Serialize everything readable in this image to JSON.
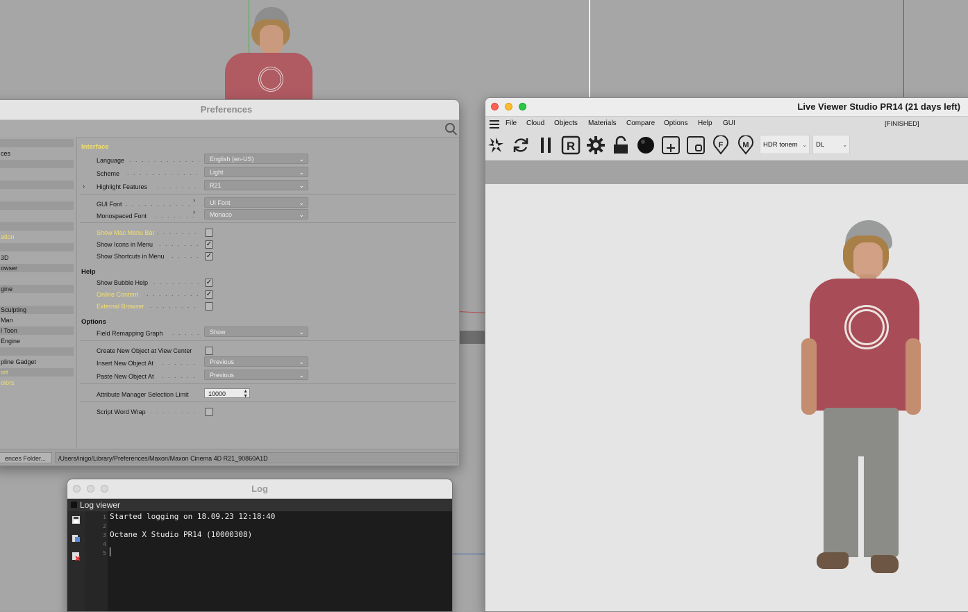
{
  "preferences": {
    "title": "Preferences",
    "sidebar": [
      {
        "label": "",
        "band": true
      },
      {
        "label": "ces",
        "band": false
      },
      {
        "label": "",
        "band": true
      },
      {
        "label": "",
        "band": false
      },
      {
        "label": "",
        "band": true
      },
      {
        "label": "",
        "band": false
      },
      {
        "label": "",
        "band": true
      },
      {
        "label": "",
        "band": false
      },
      {
        "label": "",
        "band": true
      },
      {
        "label": "ation",
        "band": false,
        "yellow": true
      },
      {
        "label": "",
        "band": true
      },
      {
        "label": "3D",
        "band": false
      },
      {
        "label": "owser",
        "band": true
      },
      {
        "label": "",
        "band": false
      },
      {
        "label": "gine",
        "band": true
      },
      {
        "label": "",
        "band": false
      },
      {
        "label": "Sculpting",
        "band": true
      },
      {
        "label": "Man",
        "band": false
      },
      {
        "label": "l Toon",
        "band": true
      },
      {
        "label": " Engine",
        "band": false
      },
      {
        "label": "",
        "band": true
      },
      {
        "label": "pline Gadget",
        "band": false
      },
      {
        "label": "ort",
        "band": true,
        "yellow": true
      },
      {
        "label": "olors",
        "band": false,
        "yellow": true
      }
    ],
    "sections": {
      "interface": "Interface",
      "help": "Help",
      "options": "Options"
    },
    "rows": {
      "language": {
        "label": "Language",
        "value": "English (en-US)"
      },
      "scheme": {
        "label": "Scheme",
        "value": "Light"
      },
      "highlight": {
        "label": "Highlight Features",
        "value": "R21"
      },
      "gui_font": {
        "label": "GUI Font",
        "value": "UI Font"
      },
      "mono_font": {
        "label": "Monospaced Font",
        "value": "Monaco"
      },
      "show_mac_menu": {
        "label": "Show Mac Menu Bar",
        "checked": false
      },
      "show_icons": {
        "label": "Show Icons in Menu",
        "checked": true
      },
      "show_shortcuts": {
        "label": "Show Shortcuts in Menu",
        "checked": true
      },
      "bubble_help": {
        "label": "Show Bubble Help",
        "checked": true
      },
      "online_content": {
        "label": "Online Content",
        "checked": true
      },
      "external_browser": {
        "label": "External Browser",
        "checked": false
      },
      "field_remap": {
        "label": "Field Remapping Graph",
        "value": "Show"
      },
      "create_new_obj": {
        "label": "Create New Object at View Center",
        "checked": false
      },
      "insert_new_obj": {
        "label": "Insert New Object At",
        "value": "Previous"
      },
      "paste_new_obj": {
        "label": "Paste New Object At",
        "value": "Previous"
      },
      "attr_limit": {
        "label": "Attribute Manager Selection Limit",
        "value": "10000"
      },
      "script_wrap": {
        "label": "Script Word Wrap",
        "checked": false
      }
    },
    "folder_button": "ences Folder...",
    "path": "/Users/inigo/Library/Preferences/Maxon/Maxon Cinema 4D R21_90860A1D"
  },
  "log": {
    "title": "Log",
    "bar_label": "Log viewer",
    "lines": [
      {
        "n": "1",
        "text": "Started logging on 18.09.23 12:18:40"
      },
      {
        "n": "2",
        "text": ""
      },
      {
        "n": "3",
        "text": "Octane X Studio PR14 (10000308)"
      },
      {
        "n": "4",
        "text": ""
      },
      {
        "n": "5",
        "text": ""
      }
    ]
  },
  "live_viewer": {
    "title": "Live Viewer Studio PR14 (21 days left)",
    "menu": [
      "File",
      "Cloud",
      "Objects",
      "Materials",
      "Compare",
      "Options",
      "Help",
      "GUI"
    ],
    "status": "[FINISHED]",
    "tonemap_select": "HDR tonem",
    "kernel_select": "DL",
    "icons": [
      "octane-logo-icon",
      "refresh-icon",
      "pause-icon",
      "region-r-icon",
      "settings-gear-icon",
      "lock-icon",
      "sphere-icon",
      "add-region-icon",
      "film-region-icon",
      "focus-pin-icon",
      "material-pin-icon"
    ],
    "colors": {
      "close": "#fe5f57",
      "minimize": "#febc2e",
      "zoom": "#28c840",
      "highlight_text": "#f3e06b"
    }
  }
}
